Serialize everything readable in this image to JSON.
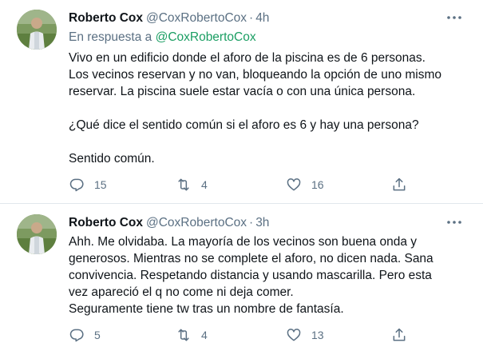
{
  "tweets": [
    {
      "author_name": "Roberto Cox",
      "handle": "@CoxRobertoCox",
      "separator": "·",
      "time": "4h",
      "reply_prefix": "En respuesta a",
      "reply_mention": "@CoxRobertoCox",
      "text": "Vivo en un edificio donde el aforo de la piscina es de 6 personas.\nLos vecinos reservan y no van, bloqueando la opción de uno mismo\nreservar. La piscina suele estar vacía o con una única persona.\n\n¿Qué dice el sentido común si el aforo es 6 y hay una persona?\n\nSentido común.",
      "replies": "15",
      "retweets": "4",
      "likes": "16"
    },
    {
      "author_name": "Roberto Cox",
      "handle": "@CoxRobertoCox",
      "separator": "·",
      "time": "3h",
      "text": "Ahh. Me olvidaba. La mayoría de los vecinos son buena onda y\ngenerosos. Mientras no se complete el aforo, no dicen nada. Sana\nconvivencia. Respetando distancia y usando mascarilla. Pero esta\nvez apareció el q no come ni deja comer.\nSeguramente tiene tw tras un nombre de fantasía.",
      "replies": "5",
      "retweets": "4",
      "likes": "13"
    }
  ],
  "colors": {
    "text": "#0f1419",
    "secondary": "#5b7083",
    "mention": "#1b9e63",
    "divider": "#e1e8ed"
  },
  "icons": [
    "more-icon",
    "reply-icon",
    "retweet-icon",
    "like-icon",
    "share-icon"
  ]
}
